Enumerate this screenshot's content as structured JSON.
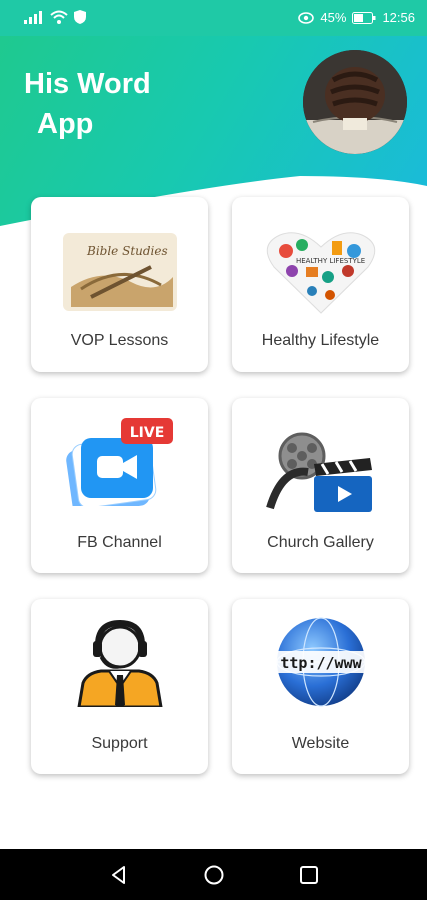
{
  "status": {
    "battery": "45%",
    "time": "12:56"
  },
  "app": {
    "title_line1": "His Word",
    "title_line2": "App"
  },
  "cards": [
    {
      "label": "VOP Lessons",
      "icon": "bible-study-icon"
    },
    {
      "label": "Healthy Lifestyle",
      "icon": "healthy-heart-icon"
    },
    {
      "label": "FB Channel",
      "icon": "live-video-icon",
      "badge": "LIVE"
    },
    {
      "label": "Church Gallery",
      "icon": "film-reel-icon"
    },
    {
      "label": "Support",
      "icon": "support-agent-icon"
    },
    {
      "label": "Website",
      "icon": "globe-www-icon",
      "globe_text": "ttp://www"
    }
  ],
  "colors": {
    "brand_start": "#1fc98f",
    "brand_end": "#1ab9e0",
    "status_bar": "#1fc9a6"
  }
}
